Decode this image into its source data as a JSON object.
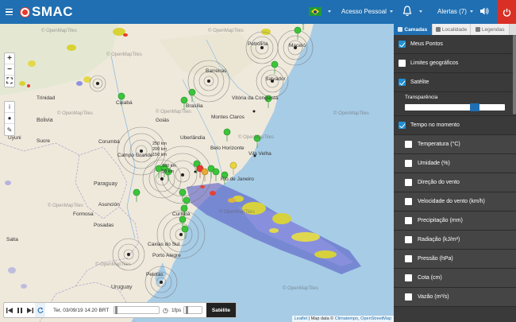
{
  "header": {
    "app_name": "SMAC",
    "acesso_label": "Acesso Pessoal",
    "alertas_label": "Alertas (7)",
    "colors": {
      "bar": "#1f6fb2",
      "power": "#d92f24",
      "logo": "#e53b2f"
    }
  },
  "map": {
    "labels": [
      {
        "text": "Cuiabá",
        "kind": "city"
      },
      {
        "text": "Brasília",
        "kind": "city"
      },
      {
        "text": "Barreiras",
        "kind": "city"
      },
      {
        "text": "Petrolina",
        "kind": "city"
      },
      {
        "text": "Maceió",
        "kind": "city"
      },
      {
        "text": "Salvador",
        "kind": "city"
      },
      {
        "text": "Vitória da Conquista",
        "kind": "city"
      },
      {
        "text": "Montes Claros",
        "kind": "city"
      },
      {
        "text": "Belo Horizonte",
        "kind": "city"
      },
      {
        "text": "Vila Velha",
        "kind": "city"
      },
      {
        "text": "Uberlândia",
        "kind": "city"
      },
      {
        "text": "Corumbá",
        "kind": "city"
      },
      {
        "text": "Campo Grande",
        "kind": "city"
      },
      {
        "text": "Paraguay",
        "kind": "country"
      },
      {
        "text": "Asunción",
        "kind": "city"
      },
      {
        "text": "Formosa",
        "kind": "city"
      },
      {
        "text": "Posadas",
        "kind": "city"
      },
      {
        "text": "Curitiba",
        "kind": "city"
      },
      {
        "text": "Caxias do Sul",
        "kind": "city"
      },
      {
        "text": "Porto Alegre",
        "kind": "city"
      },
      {
        "text": "Pelotas",
        "kind": "city"
      },
      {
        "text": "Uruguay",
        "kind": "country"
      },
      {
        "text": "Bolivia",
        "kind": "country"
      },
      {
        "text": "Trinidad",
        "kind": "city"
      },
      {
        "text": "Sucre",
        "kind": "city"
      },
      {
        "text": "Salta",
        "kind": "city"
      },
      {
        "text": "Uyuni",
        "kind": "city"
      },
      {
        "text": "Rio de Janeiro",
        "kind": "city"
      },
      {
        "text": "Goiás",
        "kind": "city"
      }
    ],
    "ring_labels": [
      "250 km",
      "200 km",
      "150 km",
      "100 km",
      "50 km"
    ],
    "watermark": "© OpenMapTiles"
  },
  "map_controls": {
    "zoom_in": "+",
    "zoom_out": "−",
    "fullscreen": "⛶",
    "tool_info": "i",
    "tool_marker": "●",
    "tool_edit": "✎"
  },
  "player": {
    "datetime": "Ter, 03/09/19 14:20 BRT",
    "fps_label": "1fps",
    "layer_button": "Satélite"
  },
  "attribution": {
    "leaflet": "Leaflet",
    "sep": " | Map data © ",
    "climatempo": "Climatempo",
    "comma": ", ",
    "osm": "OpenStreetMap"
  },
  "panel": {
    "tabs": [
      {
        "label": "Camadas",
        "active": true
      },
      {
        "label": "Localidade",
        "active": false
      },
      {
        "label": "Legendas",
        "active": false
      }
    ],
    "layers": [
      {
        "label": "Meus Pontos",
        "checked": true
      },
      {
        "label": "Limites geográficos",
        "checked": false
      },
      {
        "label": "Satélite",
        "checked": true
      }
    ],
    "transparency_label": "Transparência",
    "transparency_value": 0.72,
    "group_label": "Tempo no momento",
    "group_checked": true,
    "sublayers": [
      {
        "label": "Temperatura (°C)",
        "checked": false
      },
      {
        "label": "Umidade (%)",
        "checked": false
      },
      {
        "label": "Direção do vento",
        "checked": false
      },
      {
        "label": "Velocidade do vento (km/h)",
        "checked": false
      },
      {
        "label": "Precipitação (mm)",
        "checked": false
      },
      {
        "label": "Radiação (kJ/m²)",
        "checked": false
      },
      {
        "label": "Pressão (hPa)",
        "checked": false
      },
      {
        "label": "Cota (cm)",
        "checked": false
      },
      {
        "label": "Vazão (m³/s)",
        "checked": false
      }
    ]
  }
}
